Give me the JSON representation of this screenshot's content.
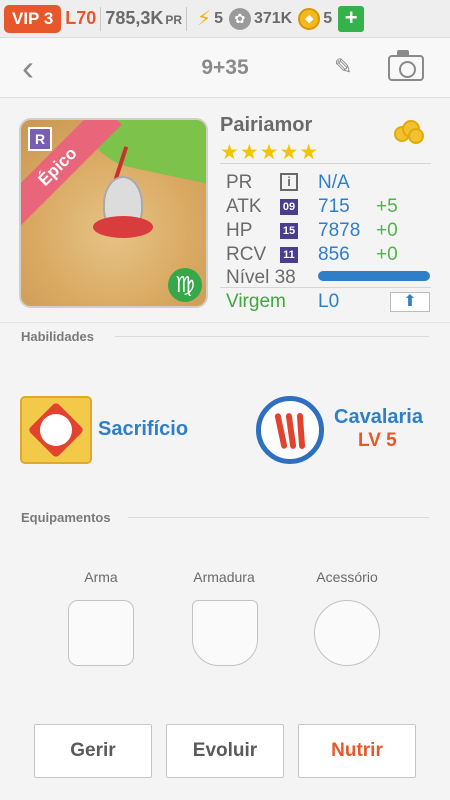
{
  "status_bar": {
    "vip": "VIP 3",
    "level": "L70",
    "power_value": "785,3K",
    "power_unit": "PR",
    "energy": "5",
    "paw_count": "371K",
    "coins": "5",
    "plus": "+"
  },
  "nav": {
    "back": "‹",
    "title": "9+35",
    "edit_icon": "pencil-icon",
    "camera_icon": "camera-icon"
  },
  "pet": {
    "name": "Pairiamor",
    "stars": "★★★★★",
    "rarity_badge": "R",
    "rarity_ribbon": "Épico",
    "zodiac_symbol": "♍",
    "stats": {
      "pr_label": "PR",
      "pr_icon": "i",
      "pr_value": "N/A",
      "atk_label": "ATK",
      "atk_badge": "09",
      "atk_value": "715",
      "atk_bonus": "+5",
      "hp_label": "HP",
      "hp_badge": "15",
      "hp_value": "7878",
      "hp_bonus": "+0",
      "rcv_label": "RCV",
      "rcv_badge": "11",
      "rcv_value": "856",
      "rcv_bonus": "+0",
      "level_label": "Nível 38",
      "level_progress": 1.0,
      "sign_label": "Virgem",
      "sign_level": "L0"
    }
  },
  "abilities": {
    "title": "Habilidades",
    "skill1_name": "Sacrifício",
    "skill2_name": "Cavalaria",
    "skill2_level": "LV 5"
  },
  "equipment": {
    "title": "Equipamentos",
    "weapon": "Arma",
    "armor": "Armadura",
    "accessory": "Acessório"
  },
  "buttons": {
    "manage": "Gerir",
    "evolve": "Evoluir",
    "feed": "Nutrir"
  },
  "colors": {
    "accent_orange": "#e8572b",
    "accent_blue": "#2f7fc8",
    "bonus_green": "#52b548"
  }
}
